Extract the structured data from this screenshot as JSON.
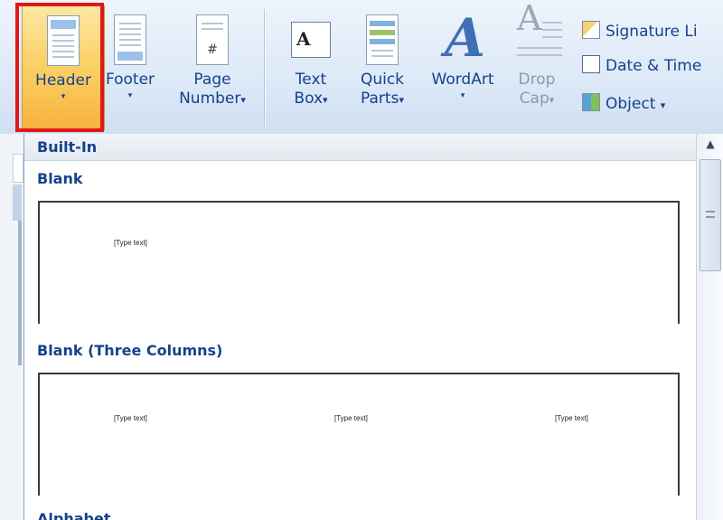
{
  "ribbon": {
    "header_label": "Header",
    "footer_label": "Footer",
    "page_number_label_1": "Page",
    "page_number_label_2": "Number",
    "text_box_label_1": "Text",
    "text_box_label_2": "Box",
    "quick_parts_label_1": "Quick",
    "quick_parts_label_2": "Parts",
    "wordart_label": "WordArt",
    "drop_cap_label_1": "Drop",
    "drop_cap_label_2": "Cap",
    "signature_line_label": "Signature Li",
    "date_time_label": "Date & Time",
    "object_label": "Object",
    "dropdown_arrow": "▾",
    "page_number_glyph": "#",
    "text_box_glyph": "A",
    "wordart_glyph": "A",
    "drop_cap_glyph": "A"
  },
  "gallery": {
    "section_header": "Built-In",
    "items": [
      {
        "title": "Blank",
        "placeholders": [
          "[Type text]"
        ]
      },
      {
        "title": "Blank (Three Columns)",
        "placeholders": [
          "[Type text]",
          "[Type text]",
          "[Type text]"
        ]
      }
    ],
    "cut_off_item": "Alphabet"
  },
  "colors": {
    "highlight_box": "#e01818",
    "ribbon_text": "#15428b",
    "active_button": "#fbd26a"
  },
  "icons": [
    "header-icon",
    "footer-icon",
    "page-number-icon",
    "text-box-icon",
    "quick-parts-icon",
    "wordart-icon",
    "drop-cap-icon",
    "signature-line-icon",
    "date-time-icon",
    "object-icon",
    "scroll-up-icon"
  ]
}
